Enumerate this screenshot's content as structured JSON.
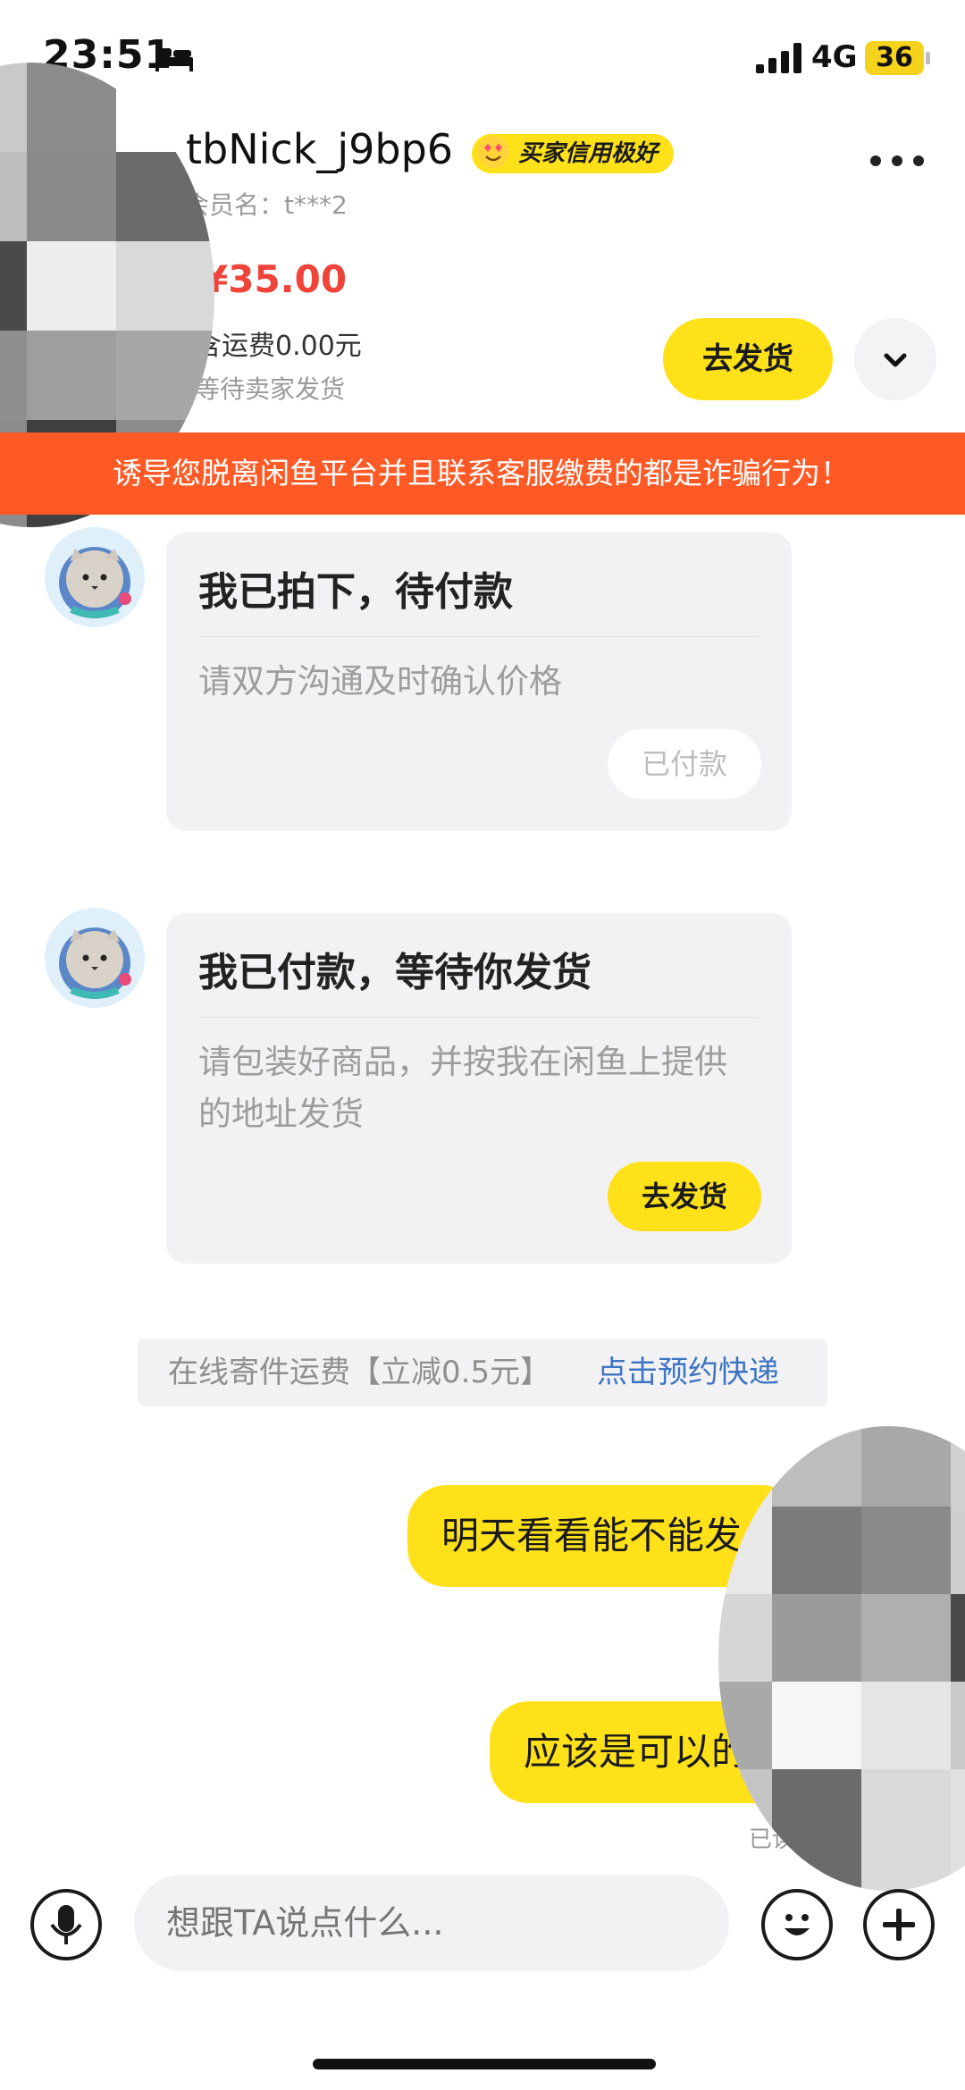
{
  "status_bar": {
    "time": "23:51",
    "network": "4G",
    "battery": "36"
  },
  "header": {
    "nickname": "tbNick_j9bp6",
    "credit_badge": "买家信用极好",
    "member_name": "会员名：t***2",
    "price": "¥35.00",
    "shipping_fee": "含运费0.00元",
    "order_status": "等待卖家发货",
    "ship_button": "去发货"
  },
  "warning": {
    "text": "诱导您脱离闲鱼平台并且联系客服缴费的都是诈骗行为！"
  },
  "messages": [
    {
      "title": "我已拍下，待付款",
      "body": "请双方沟通及时确认价格",
      "button": "已付款"
    },
    {
      "title": "我已付款，等待你发货",
      "body": "请包装好商品，并按我在闲鱼上提供的地址发货",
      "button": "去发货"
    }
  ],
  "notice": {
    "text": "在线寄件运费【立减0.5元】",
    "link": "点击预约快递"
  },
  "my_messages": [
    {
      "text": "明天看看能不能发"
    },
    {
      "text": "应该是可以的"
    }
  ],
  "read_status": "已读",
  "input": {
    "placeholder": "想跟TA说点什么..."
  },
  "colors": {
    "accent_yellow": "#ffe11a",
    "warning_orange": "#ff5a26",
    "price_red": "#f0443a",
    "link_blue": "#3d74c3"
  }
}
